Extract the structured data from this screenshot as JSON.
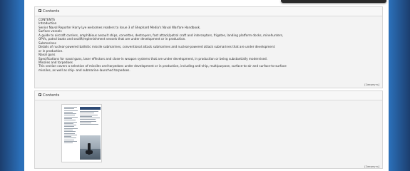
{
  "panels": [
    {
      "title": "Contents",
      "toggle_icon": "collapse-square-icon",
      "lines": [
        "CONTENTS",
        "Introduction",
        "Senior Naval Reporter Harry Lye welcomes readers to Issue 3 of Shephard Media's Naval Warfare Handbook.",
        "Surface vessels",
        "A guide to aircraft carriers, amphibious assault ships, corvettes, destroyers, fast attack/patrol craft and interceptors, frigates, landing platform docks, minehunters,",
        "OPVs, patrol boats and sealift/replenishment vessels that are under development or in production.",
        "Submarines",
        "Details of nuclear-powered ballistic missile submarines, conventional attack submarines and nuclear-powered attack submarines that are under development",
        "or in production.",
        "Naval guns",
        "Specifications for naval guns, laser effectors and close-in weapon systems that are under development, in production or being substantially modernised.",
        "Missiles and torpedoes",
        "This section covers a selection of missiles and torpedoes under development or in production, including anti-ship, multipurpose, surface-to-air and surface-to-surface",
        "missiles, as well as ship- and submarine-launched torpedoes."
      ],
      "collapse_label": "[Свернуть]"
    },
    {
      "title": "Contents",
      "toggle_icon": "collapse-square-icon",
      "collapse_label": "[Свернуть]",
      "thumbnail": "magazine-cover-thumbnail"
    }
  ]
}
